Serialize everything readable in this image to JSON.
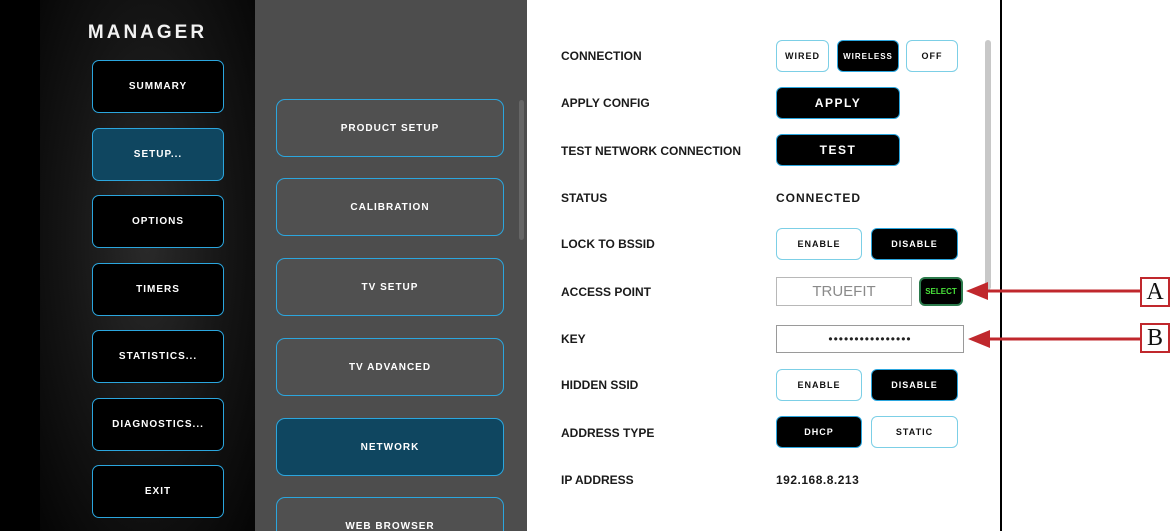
{
  "app": {
    "title": "MANAGER"
  },
  "nav": {
    "items": [
      {
        "label": "SUMMARY",
        "active": false
      },
      {
        "label": "SETUP...",
        "active": true
      },
      {
        "label": "OPTIONS",
        "active": false
      },
      {
        "label": "TIMERS",
        "active": false
      },
      {
        "label": "STATISTICS...",
        "active": false
      },
      {
        "label": "DIAGNOSTICS...",
        "active": false
      },
      {
        "label": "EXIT",
        "active": false
      }
    ]
  },
  "setup_menu": {
    "items": [
      {
        "label": "PRODUCT SETUP",
        "active": false
      },
      {
        "label": "CALIBRATION",
        "active": false
      },
      {
        "label": "TV SETUP",
        "active": false
      },
      {
        "label": "TV ADVANCED",
        "active": false
      },
      {
        "label": "NETWORK",
        "active": true
      },
      {
        "label": "WEB BROWSER",
        "active": false
      }
    ]
  },
  "network": {
    "connection": {
      "label": "CONNECTION",
      "options": [
        "WIRED",
        "WIRELESS",
        "OFF"
      ],
      "selected": "WIRELESS"
    },
    "apply_config": {
      "label": "APPLY CONFIG",
      "button": "APPLY"
    },
    "test_connection": {
      "label": "TEST NETWORK CONNECTION",
      "button": "TEST"
    },
    "status": {
      "label": "STATUS",
      "value": "CONNECTED"
    },
    "lock_bssid": {
      "label": "LOCK TO BSSID",
      "options": [
        "ENABLE",
        "DISABLE"
      ],
      "selected": "DISABLE"
    },
    "access_point": {
      "label": "ACCESS POINT",
      "value": "TRUEFIT",
      "select_button": "SELECT"
    },
    "key": {
      "label": "KEY",
      "value": "••••••••••••••••"
    },
    "hidden_ssid": {
      "label": "HIDDEN SSID",
      "options": [
        "ENABLE",
        "DISABLE"
      ],
      "selected": "DISABLE"
    },
    "address_type": {
      "label": "ADDRESS TYPE",
      "options": [
        "DHCP",
        "STATIC"
      ],
      "selected": "DHCP"
    },
    "ip_address": {
      "label": "IP ADDRESS",
      "value": "192.168.8.213"
    }
  },
  "callouts": {
    "a": "A",
    "b": "B"
  },
  "colors": {
    "accent": "#2ba6de",
    "active_fill": "#0f4660",
    "annotation": "#c0282d",
    "select_text": "#49e33a"
  }
}
